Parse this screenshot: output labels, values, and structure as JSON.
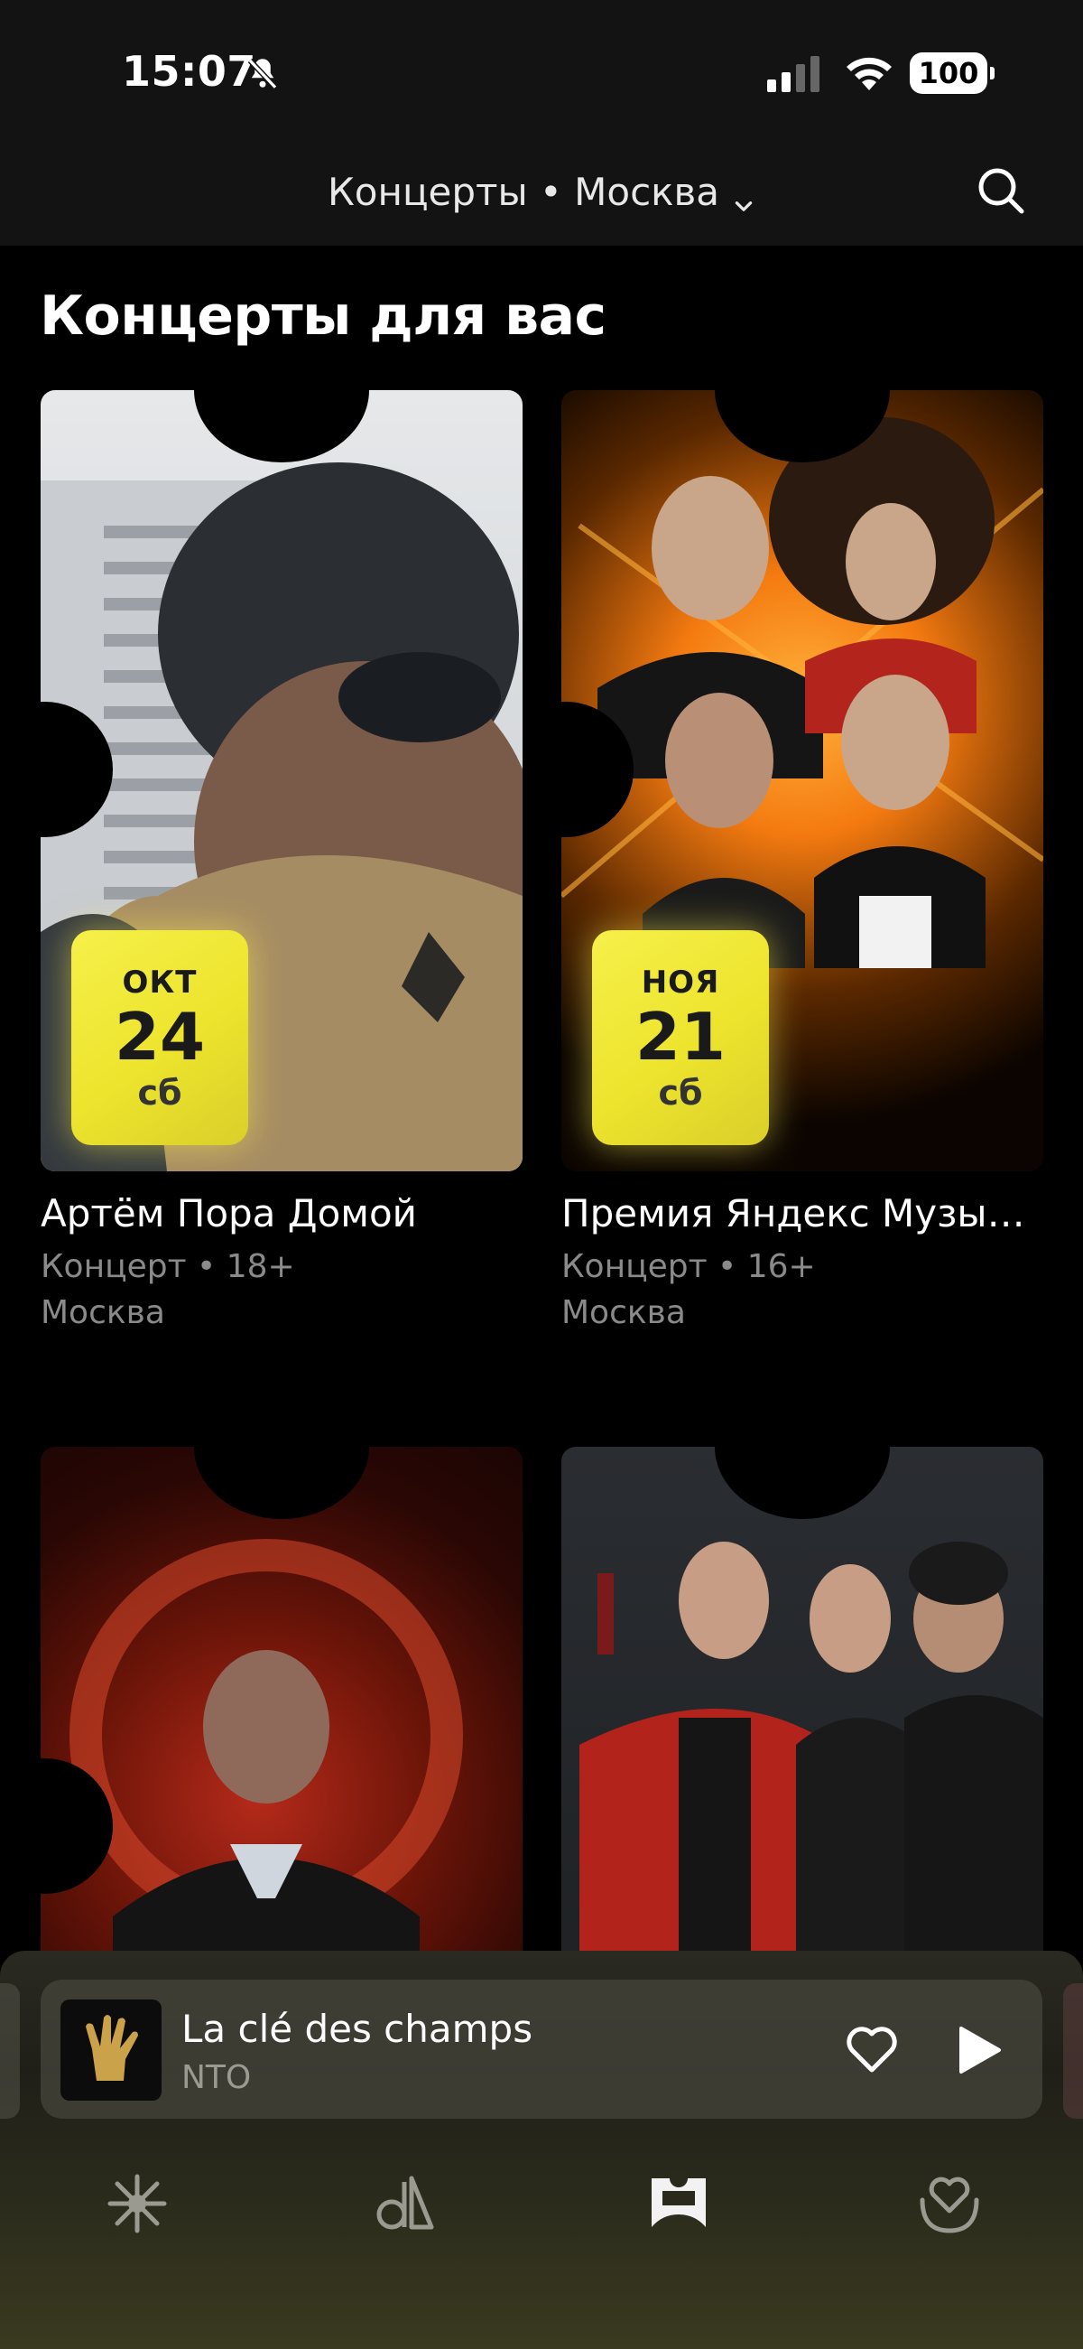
{
  "status_bar": {
    "time": "15:07",
    "battery": "100",
    "icons": [
      "bell-off-icon",
      "signal-icon",
      "wifi-icon",
      "battery-icon"
    ]
  },
  "header": {
    "title": "Концерты • Москва",
    "dropdown_icon": "chevron-down-icon",
    "search_icon": "search-icon"
  },
  "section": {
    "title": "Концерты для вас"
  },
  "cards": [
    {
      "title": "Артём Пора Домой",
      "meta": "Концерт • 18+",
      "city": "Москва",
      "date": {
        "month": "ОКТ",
        "day": "24",
        "weekday": "сб"
      }
    },
    {
      "title": "Премия Яндекс Музык...",
      "meta": "Концерт • 16+",
      "city": "Москва",
      "date": {
        "month": "НОЯ",
        "day": "21",
        "weekday": "сб"
      }
    },
    {
      "title": "",
      "meta": "",
      "city": ""
    },
    {
      "title": "",
      "meta": "",
      "city": ""
    }
  ],
  "player": {
    "track": "La clé des champs",
    "artist": "NTO",
    "like_icon": "heart-icon",
    "play_icon": "play-icon"
  },
  "tabbar": {
    "items": [
      {
        "icon": "sparkle-icon"
      },
      {
        "icon": "library-icon"
      },
      {
        "icon": "ticket-icon",
        "active": true
      },
      {
        "icon": "heart-collection-icon"
      }
    ]
  },
  "colors": {
    "background": "#000000",
    "bar": "#131313",
    "badge_yellow": "#f3ec3b",
    "muted_text": "#8a8a8a"
  }
}
